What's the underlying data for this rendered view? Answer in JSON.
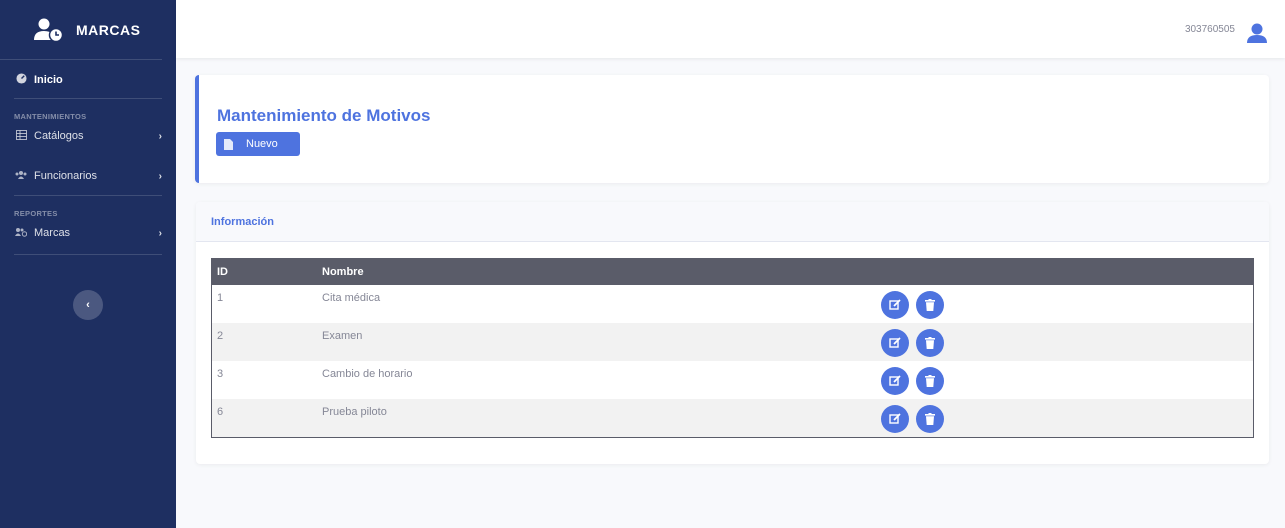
{
  "sidebar": {
    "brand": "MARCAS",
    "inicio": "Inicio",
    "heading_mantenimientos": "MANTENIMIENTOS",
    "catalogos": "Catálogos",
    "funcionarios": "Funcionarios",
    "heading_reportes": "REPORTES",
    "marcas": "Marcas",
    "toggle_icon": "chevron-left-icon"
  },
  "topbar": {
    "user_id": "303760505",
    "user_icon": "user-icon"
  },
  "page": {
    "title": "Mantenimiento de Motivos",
    "nuevo_label": "Nuevo"
  },
  "info_card": {
    "header": "Información"
  },
  "table": {
    "columns": [
      "ID",
      "Nombre"
    ],
    "rows": [
      {
        "id": "1",
        "nombre": "Cita médica"
      },
      {
        "id": "2",
        "nombre": "Examen"
      },
      {
        "id": "3",
        "nombre": "Cambio de horario"
      },
      {
        "id": "6",
        "nombre": "Prueba piloto"
      }
    ]
  },
  "colors": {
    "sidebar": "#1e2f61",
    "primary": "#4e73df",
    "table_header": "#5a5c69"
  }
}
